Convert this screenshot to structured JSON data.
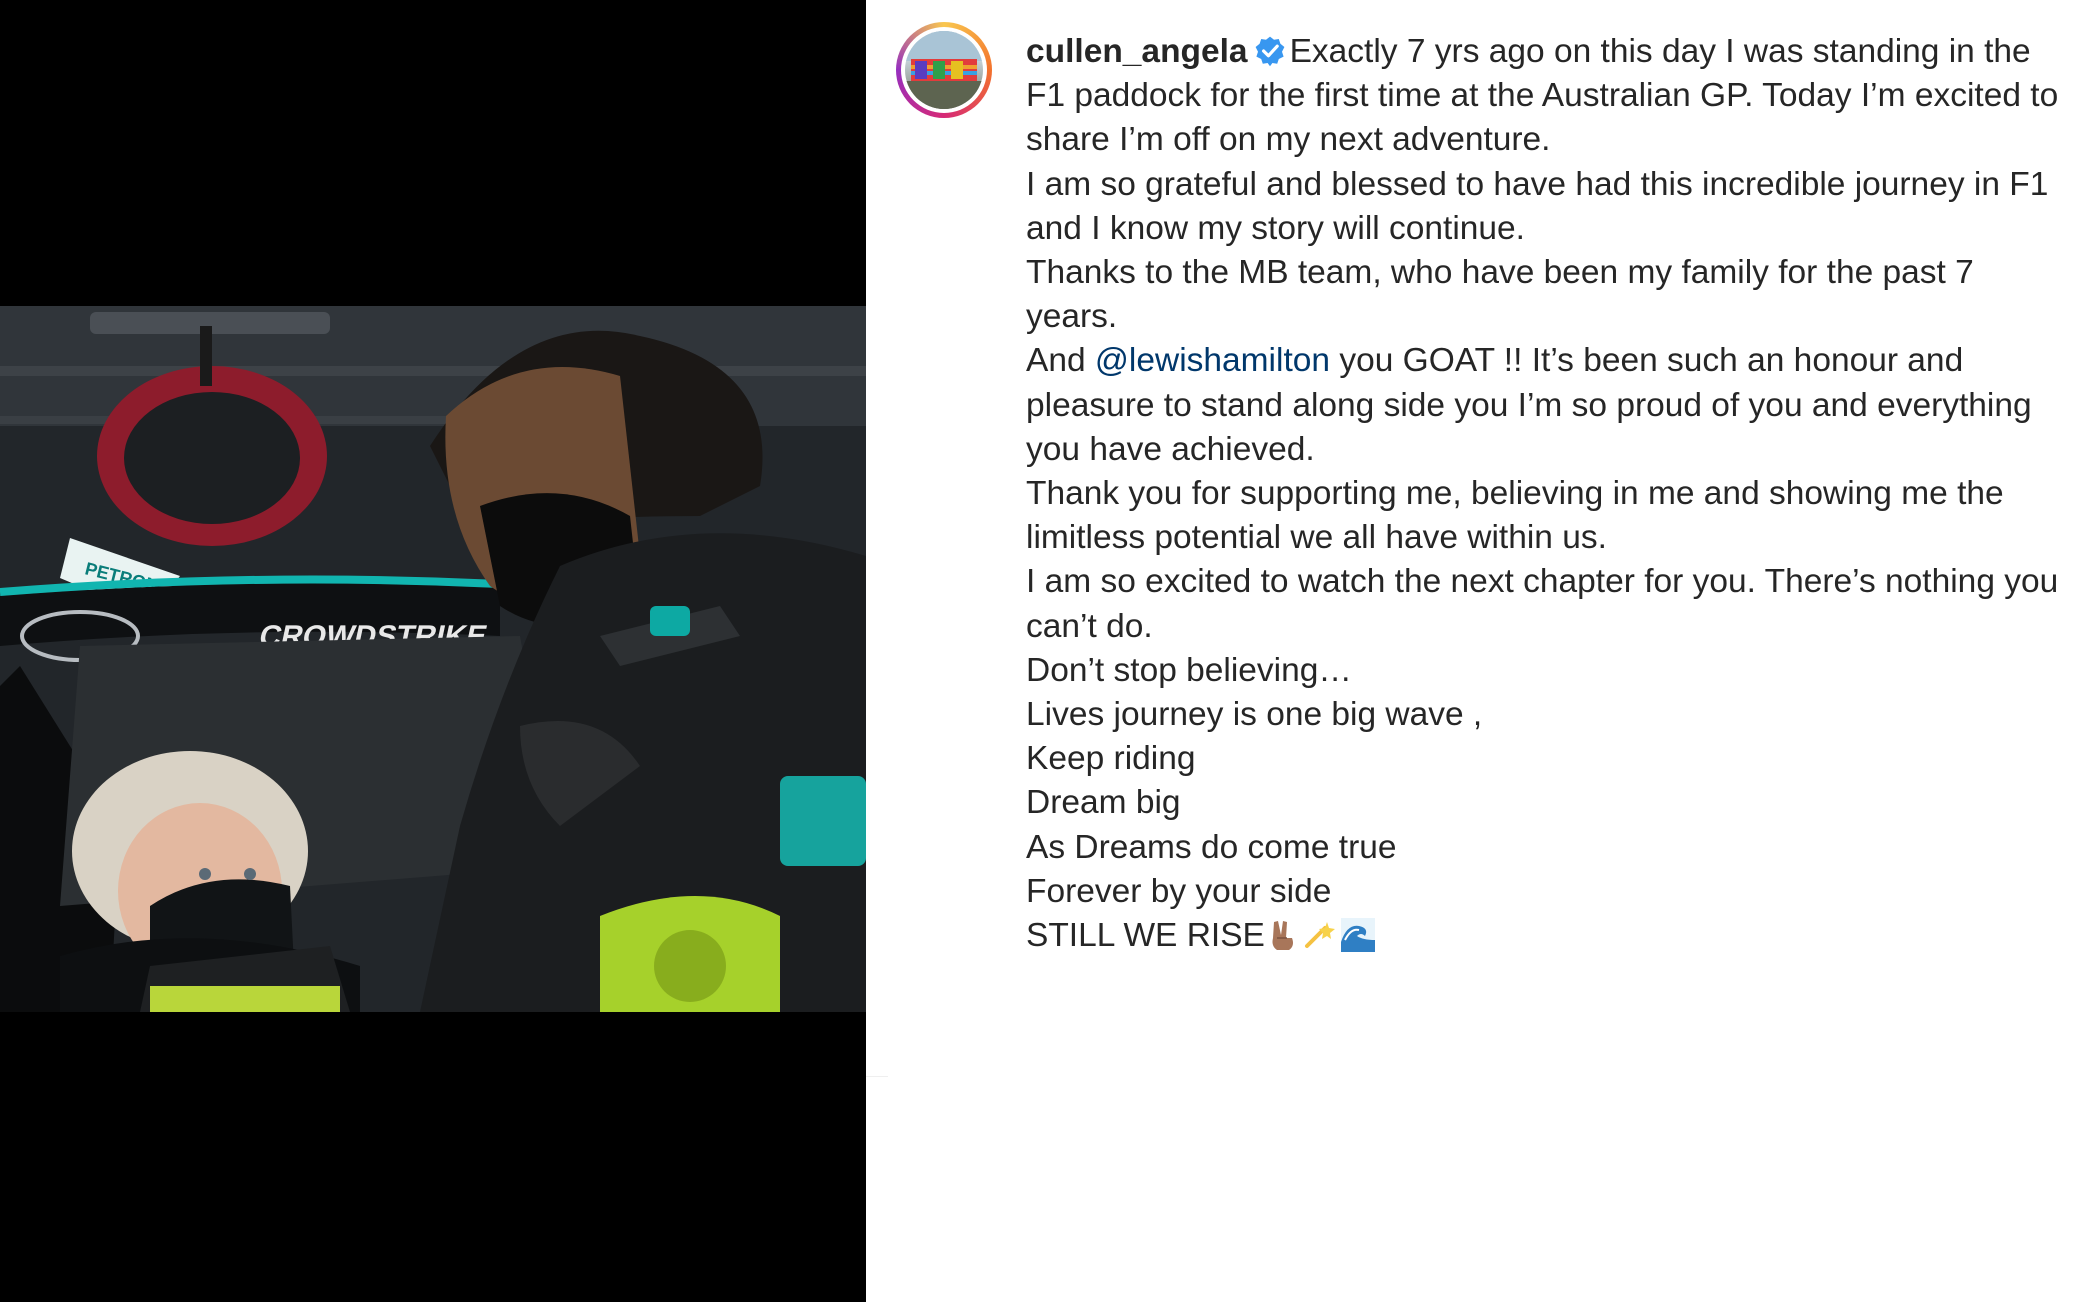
{
  "post": {
    "username": "cullen_angela",
    "lines": {
      "l1": "Exactly 7 yrs ago on this day I was standing in the F1 paddock for the first time at the Australian GP. Today I’m excited to share I’m off on my next adventure.",
      "l2": "I am so grateful and blessed to have had this incredible journey in F1 and I know my story will continue.",
      "l3": "Thanks to the MB team, who have been my family for the past 7 years.",
      "l4_pre": "And ",
      "l4_mention": "@lewishamilton",
      "l4_post": " you GOAT !! It’s been such an honour and pleasure to stand along side you I’m so proud of you and everything you have achieved.",
      "l5": "Thank you for supporting me, believing in me and showing me the limitless potential we all have within us.",
      "l6": "I am so excited to watch the next chapter for you. There’s nothing you can’t do.",
      "l7": "Don’t stop believing…",
      "l8": "Lives journey is one big wave ,",
      "l9": "Keep riding",
      "l10": "Dream big",
      "l11": "As Dreams do come true",
      "l12": "Forever by your side",
      "l13": "STILL WE RISE"
    }
  },
  "photo": {
    "halo_sponsor": "CROWDSTRIKE",
    "petronas": "PETRON"
  },
  "icons": {
    "verified": "verified-badge-icon",
    "emojis": [
      "victory-hand-emoji",
      "dizzy-emoji",
      "water-wave-emoji"
    ]
  },
  "colors": {
    "mention": "#00376b",
    "verified": "#3897f0",
    "text": "#262626"
  }
}
